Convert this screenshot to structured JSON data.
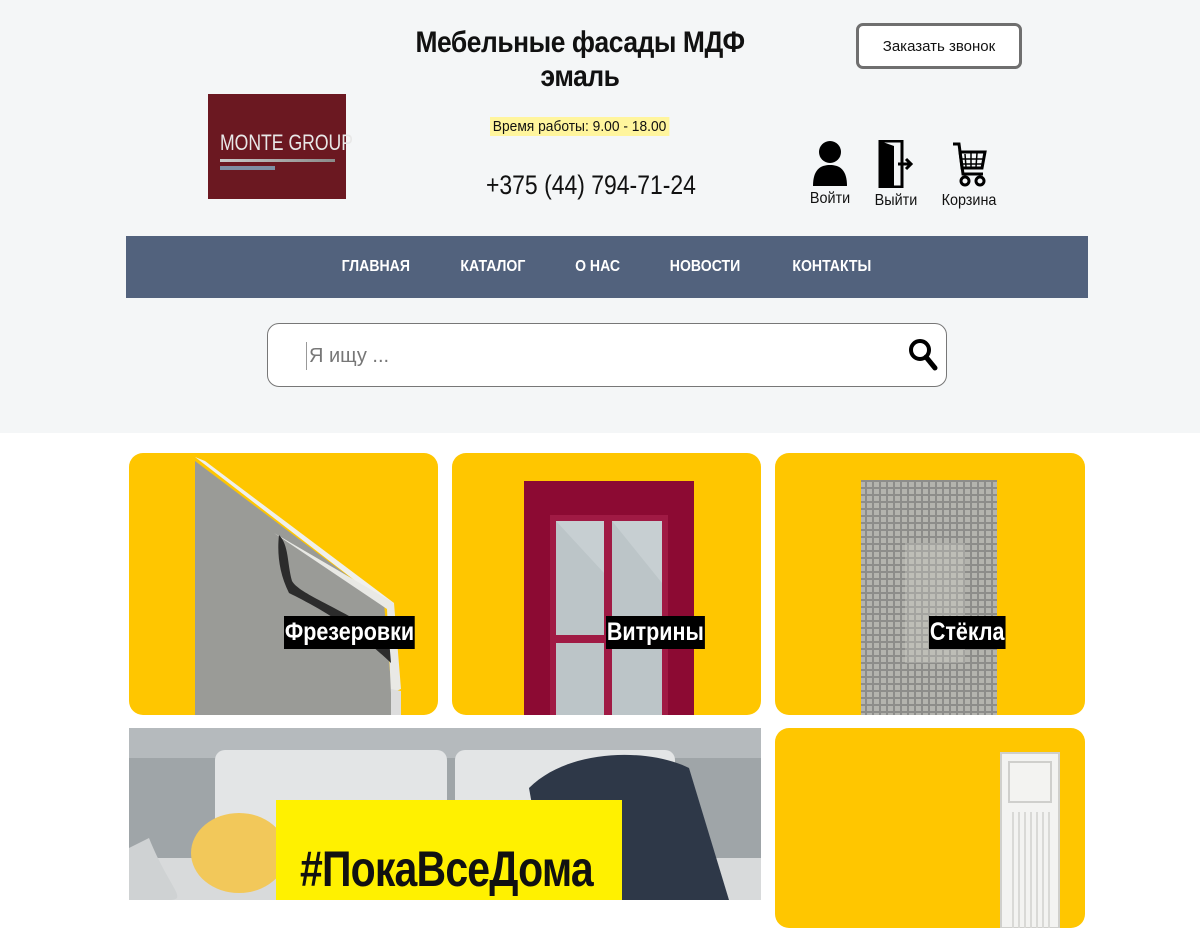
{
  "header": {
    "title": "Мебельные фасады МДФ эмаль",
    "callback_button": "Заказать звонок",
    "logo": "MONTE GROUP",
    "hours": "Время работы: 9.00 - 18.00",
    "phone": "+375 (44) 794-71-24"
  },
  "account": {
    "login": "Войти",
    "logout": "Выйти",
    "cart": "Корзина"
  },
  "nav": {
    "items": [
      {
        "label": "ГЛАВНАЯ"
      },
      {
        "label": "КАТАЛОГ"
      },
      {
        "label": "О НАС"
      },
      {
        "label": "НОВОСТИ"
      },
      {
        "label": "КОНТАКТЫ"
      }
    ]
  },
  "search": {
    "placeholder": "Я ищу ..."
  },
  "categories": [
    {
      "label": "Фрезеровки"
    },
    {
      "label": "Витрины"
    },
    {
      "label": "Стёкла"
    }
  ],
  "banner": {
    "text": "#ПокаВсеДома"
  },
  "colors": {
    "nav_bg": "#52627d",
    "tile_bg": "#ffc600",
    "logo_bg": "#6b1821",
    "hours_highlight": "#fff59d",
    "banner_highlight": "#fff100"
  }
}
